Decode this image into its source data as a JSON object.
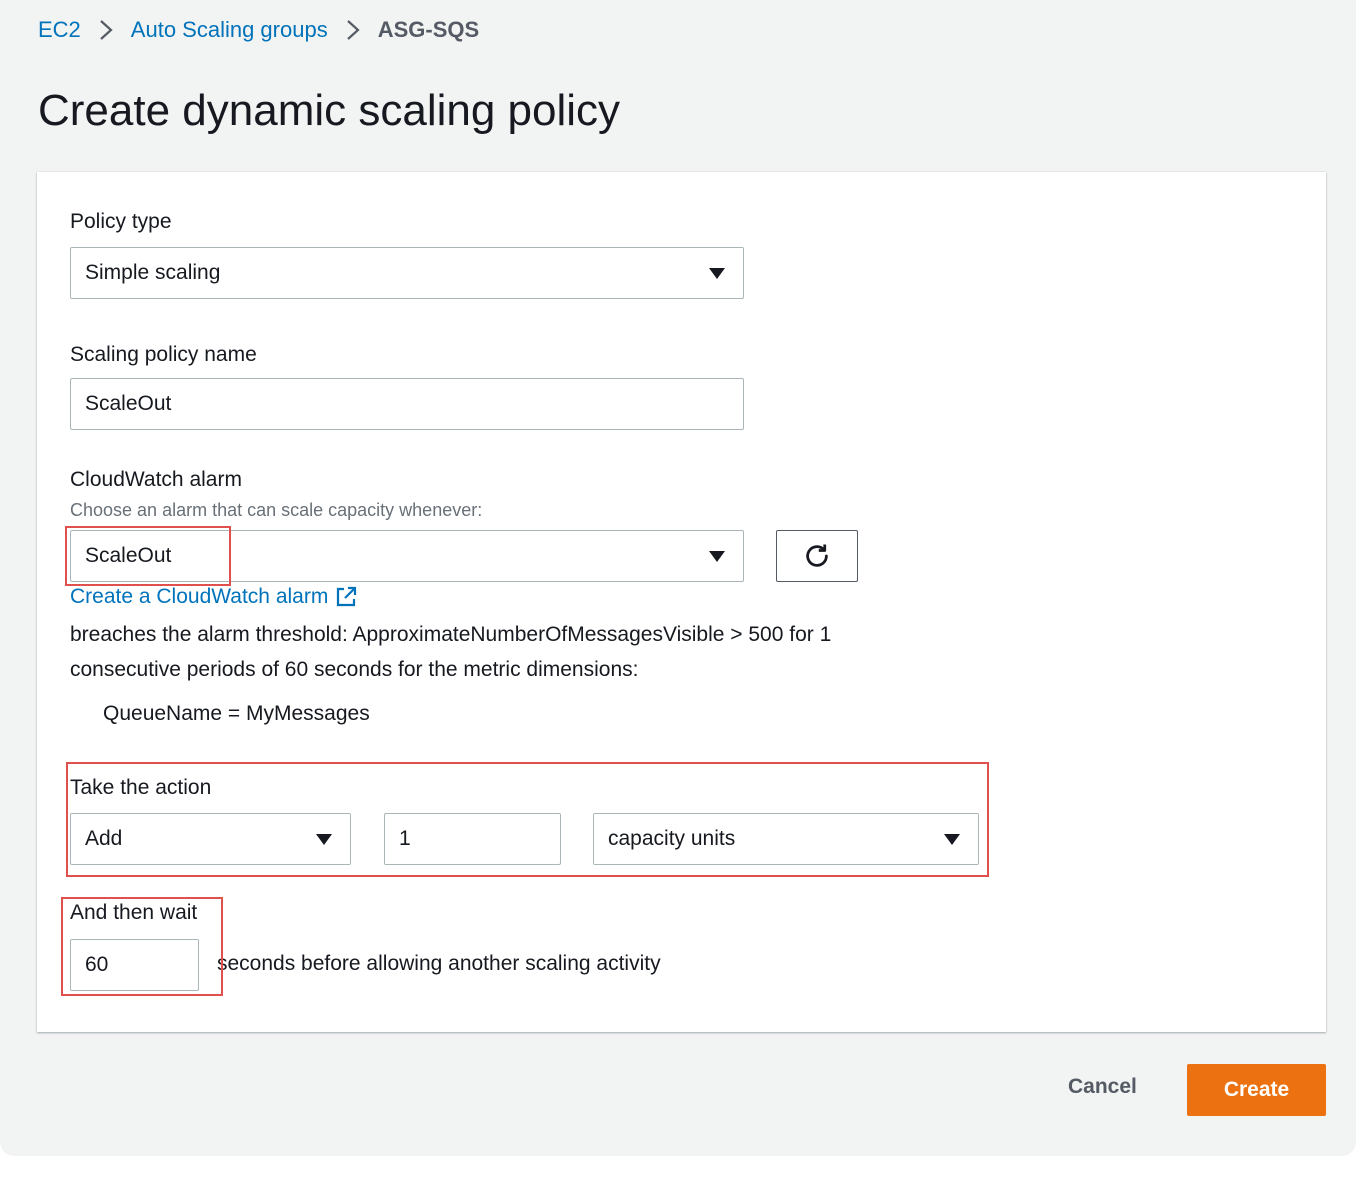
{
  "breadcrumb": {
    "items": [
      "EC2",
      "Auto Scaling groups"
    ],
    "current": "ASG-SQS"
  },
  "page": {
    "title": "Create dynamic scaling policy"
  },
  "form": {
    "policy_type": {
      "label": "Policy type",
      "value": "Simple scaling"
    },
    "policy_name": {
      "label": "Scaling policy name",
      "value": "ScaleOut"
    },
    "alarm": {
      "label": "CloudWatch alarm",
      "description": "Choose an alarm that can scale capacity whenever:",
      "value": "ScaleOut",
      "create_link": "Create a CloudWatch alarm",
      "threshold_text_1": "breaches the alarm threshold: ApproximateNumberOfMessagesVisible > 500 for 1",
      "threshold_text_2": "consecutive periods of 60 seconds for the metric dimensions:",
      "dimension": "QueueName = MyMessages"
    },
    "action": {
      "label": "Take the action",
      "operation": "Add",
      "amount": "1",
      "unit": "capacity units"
    },
    "wait": {
      "label": "And then wait",
      "value": "60",
      "suffix": "seconds before allowing another scaling activity"
    }
  },
  "footer": {
    "cancel_label": "Cancel",
    "create_label": "Create"
  },
  "colors": {
    "link": "#0073bb",
    "primary": "#ec7211",
    "highlight": "#e0504d",
    "background": "#f2f3f3"
  }
}
